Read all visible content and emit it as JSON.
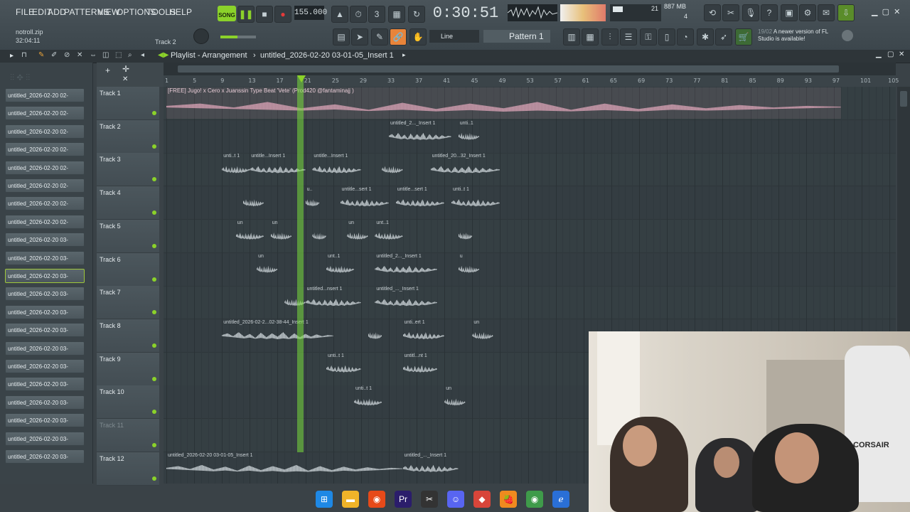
{
  "menu": [
    "FILE",
    "EDIT",
    "ADD",
    "PATTERNS",
    "VIEW",
    "OPTIONS",
    "TOOLS",
    "HELP"
  ],
  "transport": {
    "mode": "SONG",
    "tempo": "155.000",
    "time": "0:30:51",
    "cpu_top": "21",
    "ram": "887 MB",
    "cpu_bottom": "4"
  },
  "hint_panel": {
    "file": "notroll.zip",
    "time": "32:04:11",
    "track": "Track 2"
  },
  "snap": "Line",
  "pattern": "Pattern 1",
  "news": {
    "date": "19/02",
    "text": "A newer version of FL Studio is available!"
  },
  "playlist": {
    "title": "Playlist - Arrangement",
    "project": "untitled_2026-02-20 03-01-05_Insert 1"
  },
  "ruler_ticks": [
    "1",
    "5",
    "9",
    "13",
    "17",
    "21",
    "25",
    "29",
    "33",
    "37",
    "41",
    "45",
    "49",
    "53",
    "57",
    "61",
    "65",
    "69",
    "73",
    "77",
    "81",
    "85",
    "89",
    "93",
    "97",
    "101",
    "105"
  ],
  "browser_items": [
    "untitled_2026-02-20 02-",
    "untitled_2026-02-20 02-",
    "untitled_2026-02-20 02-",
    "untitled_2026-02-20 02-",
    "untitled_2026-02-20 02-",
    "untitled_2026-02-20 02-",
    "untitled_2026-02-20 02-",
    "untitled_2026-02-20 02-",
    "untitled_2026-02-20 03-",
    "untitled_2026-02-20 03-",
    "untitled_2026-02-20 03-",
    "untitled_2026-02-20 03-",
    "untitled_2026-02-20 03-",
    "untitled_2026-02-20 03-",
    "untitled_2026-02-20 03-",
    "untitled_2026-02-20 03-",
    "untitled_2026-02-20 03-",
    "untitled_2026-02-20 03-",
    "untitled_2026-02-20 03-",
    "untitled_2026-02-20 03-",
    "untitled_2026-02-20 03-"
  ],
  "selected_browser_index": 10,
  "tracks": [
    {
      "name": "Track 1"
    },
    {
      "name": "Track 2"
    },
    {
      "name": "Track 3"
    },
    {
      "name": "Track 4"
    },
    {
      "name": "Track 5"
    },
    {
      "name": "Track 6"
    },
    {
      "name": "Track 7"
    },
    {
      "name": "Track 8"
    },
    {
      "name": "Track 9"
    },
    {
      "name": "Track 10"
    },
    {
      "name": "Track 11"
    },
    {
      "name": "Track 12"
    }
  ],
  "clips": [
    {
      "track": 0,
      "start": 1,
      "end": 98,
      "label": "[FREE] Jugo! x Cero x Juanssin Type Beat 'Vete' (Prod420 @fantaminajj )",
      "big": true,
      "color": "#d4a3b5"
    },
    {
      "track": 1,
      "start": 33,
      "end": 42,
      "label": "untitled_2..._Insert 1"
    },
    {
      "track": 1,
      "start": 43,
      "end": 46,
      "label": "unti..1"
    },
    {
      "track": 2,
      "start": 9,
      "end": 13,
      "label": "unti..t 1"
    },
    {
      "track": 2,
      "start": 13,
      "end": 21,
      "label": "untitle...Insert 1"
    },
    {
      "track": 2,
      "start": 22,
      "end": 29,
      "label": "untitle...Insert 1"
    },
    {
      "track": 2,
      "start": 32,
      "end": 35,
      "label": ""
    },
    {
      "track": 2,
      "start": 39,
      "end": 49,
      "label": "untitled_20...32_Insert 1"
    },
    {
      "track": 3,
      "start": 12,
      "end": 15,
      "label": ""
    },
    {
      "track": 3,
      "start": 21,
      "end": 23,
      "label": "u.."
    },
    {
      "track": 3,
      "start": 26,
      "end": 33,
      "label": "untitle...sert 1"
    },
    {
      "track": 3,
      "start": 34,
      "end": 41,
      "label": "untitle...sert 1"
    },
    {
      "track": 3,
      "start": 42,
      "end": 49,
      "label": "unti..t 1"
    },
    {
      "track": 4,
      "start": 11,
      "end": 15,
      "label": "un"
    },
    {
      "track": 4,
      "start": 16,
      "end": 19,
      "label": "un"
    },
    {
      "track": 4,
      "start": 22,
      "end": 24,
      "label": ""
    },
    {
      "track": 4,
      "start": 27,
      "end": 30,
      "label": "un"
    },
    {
      "track": 4,
      "start": 31,
      "end": 35,
      "label": "unt..1"
    },
    {
      "track": 4,
      "start": 43,
      "end": 45,
      "label": ""
    },
    {
      "track": 5,
      "start": 14,
      "end": 17,
      "label": "un"
    },
    {
      "track": 5,
      "start": 24,
      "end": 28,
      "label": "unt..1"
    },
    {
      "track": 5,
      "start": 31,
      "end": 40,
      "label": "untitled_2..._Insert 1"
    },
    {
      "track": 5,
      "start": 43,
      "end": 46,
      "label": "u"
    },
    {
      "track": 6,
      "start": 18,
      "end": 21,
      "label": ""
    },
    {
      "track": 6,
      "start": 21,
      "end": 29,
      "label": "untitled...nsert 1"
    },
    {
      "track": 6,
      "start": 31,
      "end": 40,
      "label": "untitled_..._Insert 1"
    },
    {
      "track": 7,
      "start": 9,
      "end": 25,
      "label": "untitled_2026-02-2...02-38-44_Insert 1"
    },
    {
      "track": 7,
      "start": 30,
      "end": 32,
      "label": ""
    },
    {
      "track": 7,
      "start": 35,
      "end": 41,
      "label": "unti..ert 1"
    },
    {
      "track": 7,
      "start": 45,
      "end": 48,
      "label": "un"
    },
    {
      "track": 8,
      "start": 24,
      "end": 29,
      "label": "unti..t 1"
    },
    {
      "track": 8,
      "start": 35,
      "end": 40,
      "label": "untitl...nt 1"
    },
    {
      "track": 9,
      "start": 28,
      "end": 32,
      "label": "unti..t 1"
    },
    {
      "track": 9,
      "start": 41,
      "end": 44,
      "label": "un"
    },
    {
      "track": 11,
      "start": 1,
      "end": 35,
      "label": "untitled_2026-02-20 03-01-05_Insert 1"
    },
    {
      "track": 11,
      "start": 35,
      "end": 43,
      "label": "untitled_..._Insert 1"
    }
  ],
  "taskbar": [
    "windows-icon",
    "folder-icon",
    "chrome-icon",
    "premiere-icon",
    "capcut-icon",
    "discord-icon",
    "app-icon",
    "fl-studio-icon",
    "chrome-alt-icon",
    "edge-icon"
  ],
  "webcam_brand": "CORSAIR"
}
